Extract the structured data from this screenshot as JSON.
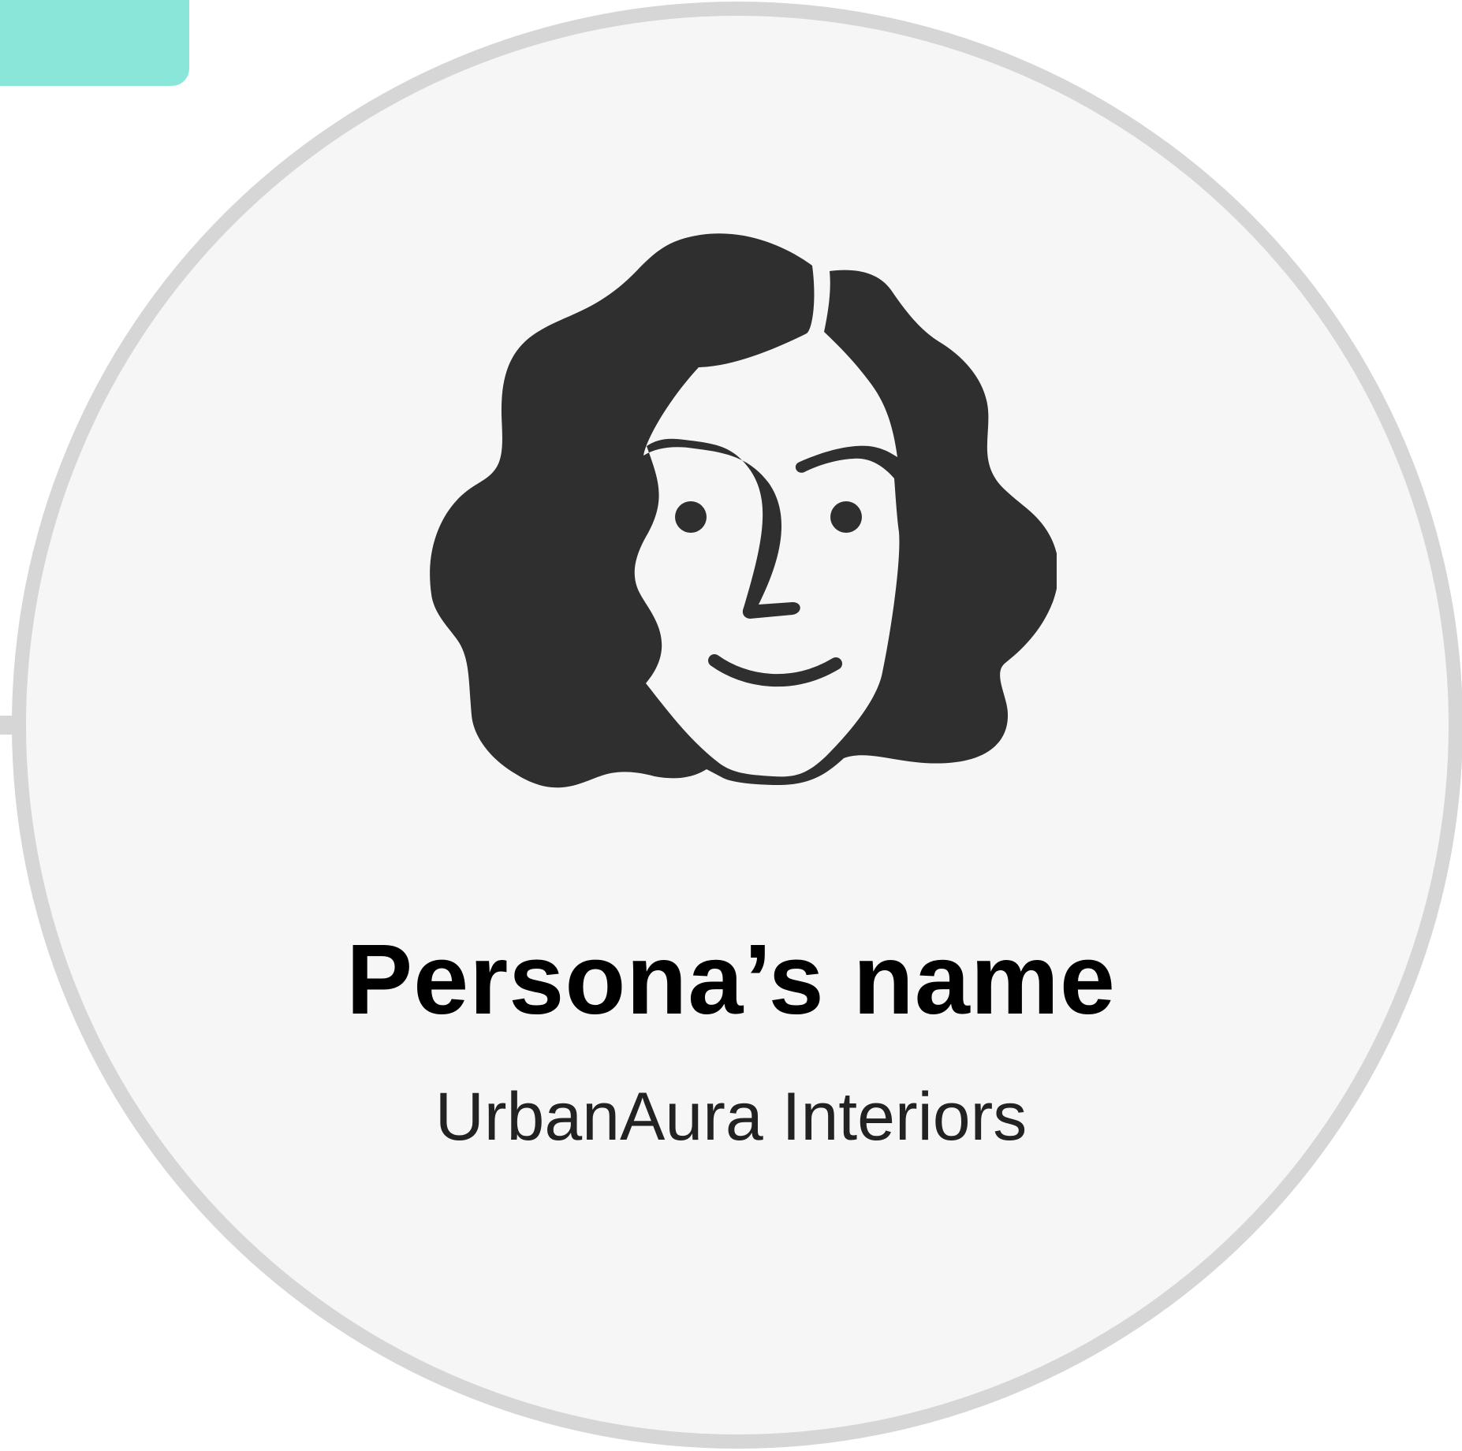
{
  "colors": {
    "tab": "#8ae6d9",
    "ring": "#d6d6d6",
    "card_background": "#f6f6f6",
    "avatar": "#2f2f2f",
    "name_text": "#000000",
    "company_text": "#222222"
  },
  "icons": {
    "avatar": "woman-face-icon"
  },
  "persona": {
    "name": "Persona’s name",
    "company": "UrbanAura Interiors"
  }
}
